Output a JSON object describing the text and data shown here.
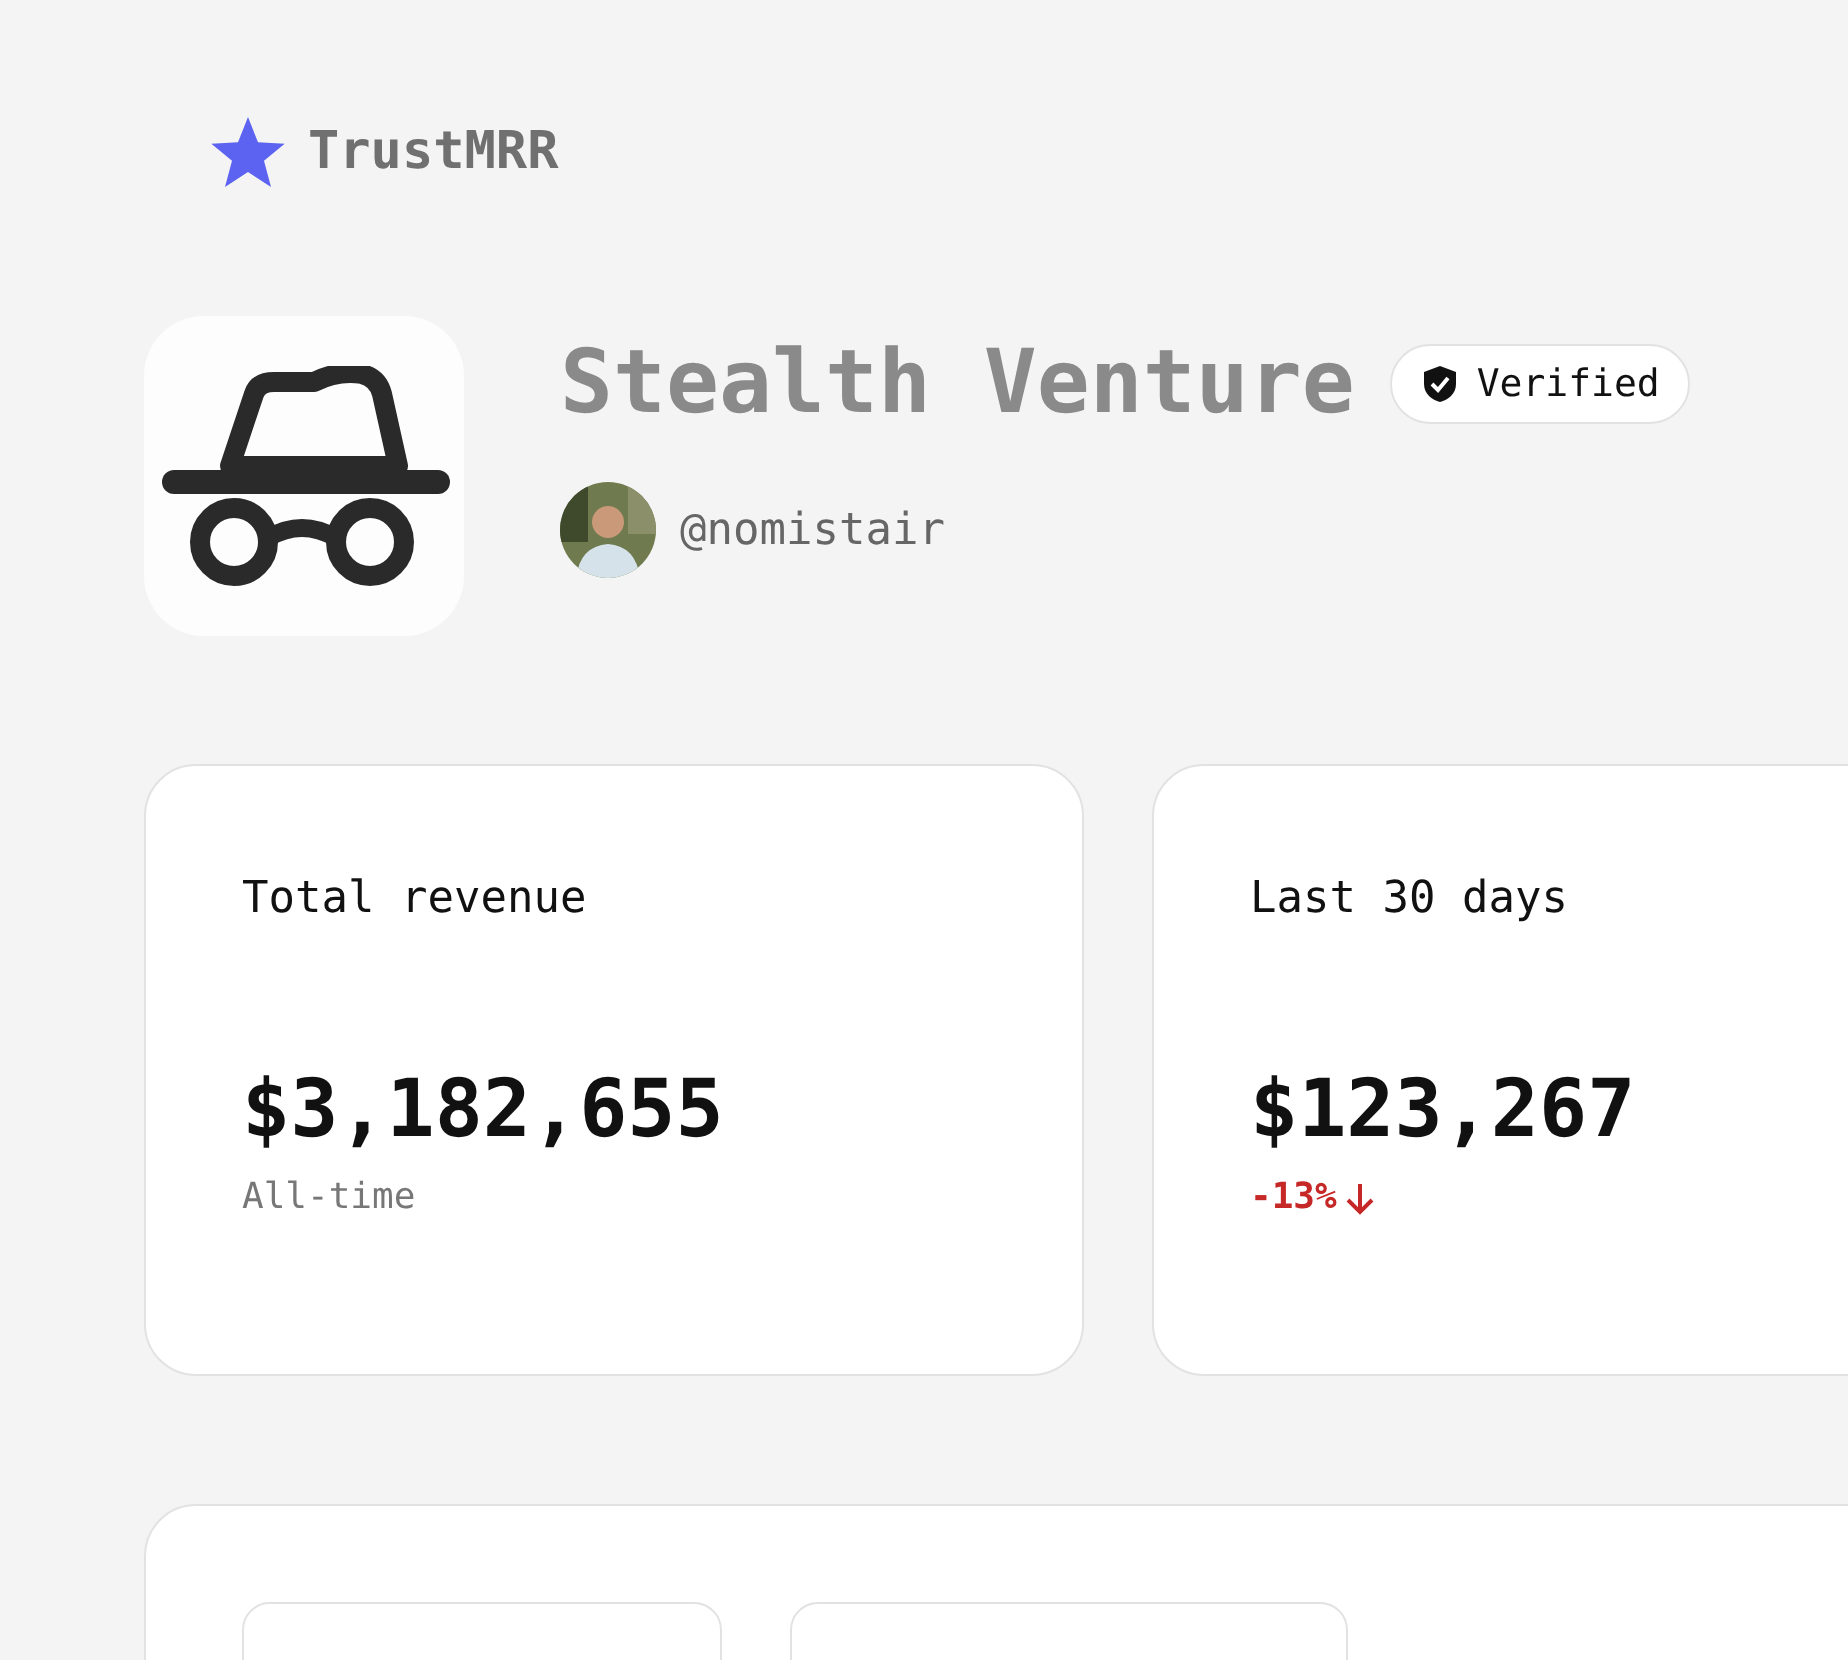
{
  "brand": {
    "name": "TrustMRR"
  },
  "startup": {
    "name": "Stealth Venture",
    "verified": true,
    "badge": "Verified",
    "founder": "@nomistair"
  },
  "stats": [
    {
      "label": "Total revenue",
      "value": "$3,182,655",
      "note": "All-time",
      "kind": "plain"
    },
    {
      "label": "Last 30 days",
      "value": "$123,267",
      "note": "-13%",
      "kind": "down"
    }
  ]
}
